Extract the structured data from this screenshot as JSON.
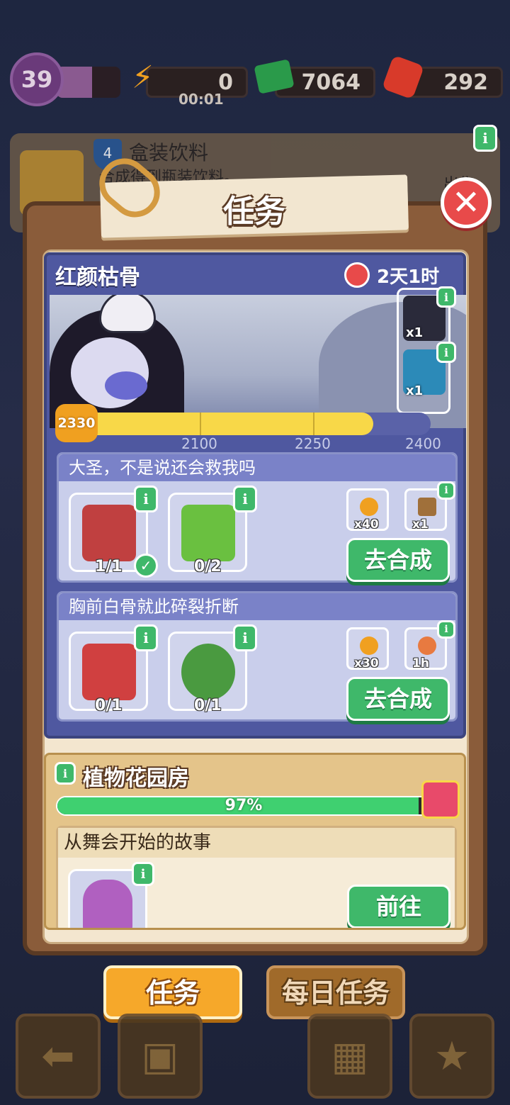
{
  "topbar": {
    "level": "39",
    "level_progress": 0.55,
    "energy": "0",
    "energy_timer": "00:01",
    "cash": "7064",
    "gems": "292"
  },
  "background_card": {
    "badge_number": "4",
    "title": "盒装饮料",
    "desc": "合成得到瓶装饮料。",
    "side_text": "出售"
  },
  "panel": {
    "title": "任务",
    "close_icon": "close-icon"
  },
  "event": {
    "title": "红颜枯骨",
    "timer": "2天1时",
    "score": "2330",
    "progress_max": 2400,
    "progress_min": 1950,
    "progress_value": 2330,
    "ticks": [
      "2100",
      "2250",
      "2400"
    ],
    "rewards": [
      {
        "name": "character-card",
        "count": "x1"
      },
      {
        "name": "treasure-chest",
        "count": "x1"
      }
    ]
  },
  "tasks": [
    {
      "title": "大圣，不是说还会救我吗",
      "items": [
        {
          "icon": "axe-stone-icon",
          "count": "1/1",
          "done": true
        },
        {
          "icon": "potted-tree-icon",
          "count": "0/2",
          "done": false
        }
      ],
      "rewards": [
        {
          "icon": "sun-coin-icon",
          "count": "x40"
        },
        {
          "icon": "chest-icon",
          "count": "x1"
        }
      ],
      "button": "去合成"
    },
    {
      "title": "胸前白骨就此碎裂折断",
      "items": [
        {
          "icon": "saw-icon",
          "count": "0/1",
          "done": false
        },
        {
          "icon": "bush-icon",
          "count": "0/1",
          "done": false
        }
      ],
      "rewards": [
        {
          "icon": "sun-coin-icon",
          "count": "x30"
        },
        {
          "icon": "hourglass-icon",
          "count": "1h"
        }
      ],
      "button": "去合成"
    }
  ],
  "garden": {
    "title": "植物花园房",
    "progress": "97%",
    "progress_value": 0.97,
    "story_title": "从舞会开始的故事",
    "story_button": "前往"
  },
  "tabs": {
    "active": "任务",
    "inactive": "每日任务"
  },
  "nav": [
    "back-arrow-icon",
    "backpack-icon",
    "basket-icon",
    "star-card-icon"
  ]
}
